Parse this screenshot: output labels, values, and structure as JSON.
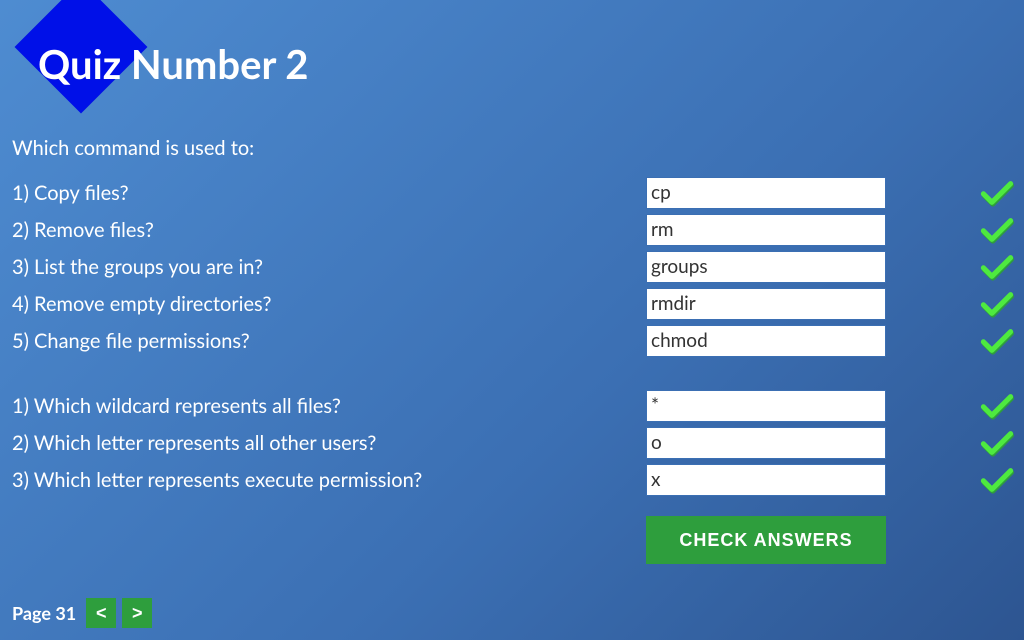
{
  "header": {
    "title": "Quiz Number 2"
  },
  "prompt": "Which command is used to:",
  "group1": [
    {
      "q": "1) Copy files?",
      "a": "cp"
    },
    {
      "q": "2) Remove files?",
      "a": "rm"
    },
    {
      "q": "3) List the groups you are in?",
      "a": "groups"
    },
    {
      "q": "4) Remove empty directories?",
      "a": "rmdir"
    },
    {
      "q": "5) Change file permissions?",
      "a": "chmod"
    }
  ],
  "group2": [
    {
      "q": "1) Which wildcard represents all files?",
      "a": "*"
    },
    {
      "q": "2) Which letter represents all other users?",
      "a": "o"
    },
    {
      "q": "3) Which letter represents execute permission?",
      "a": "x"
    }
  ],
  "buttons": {
    "check": "CHECK ANSWERS",
    "prev": "<",
    "next": ">"
  },
  "footer": {
    "page_label": "Page 31"
  },
  "colors": {
    "accent_green": "#2e9e3d",
    "diamond_blue": "#0010e8"
  }
}
